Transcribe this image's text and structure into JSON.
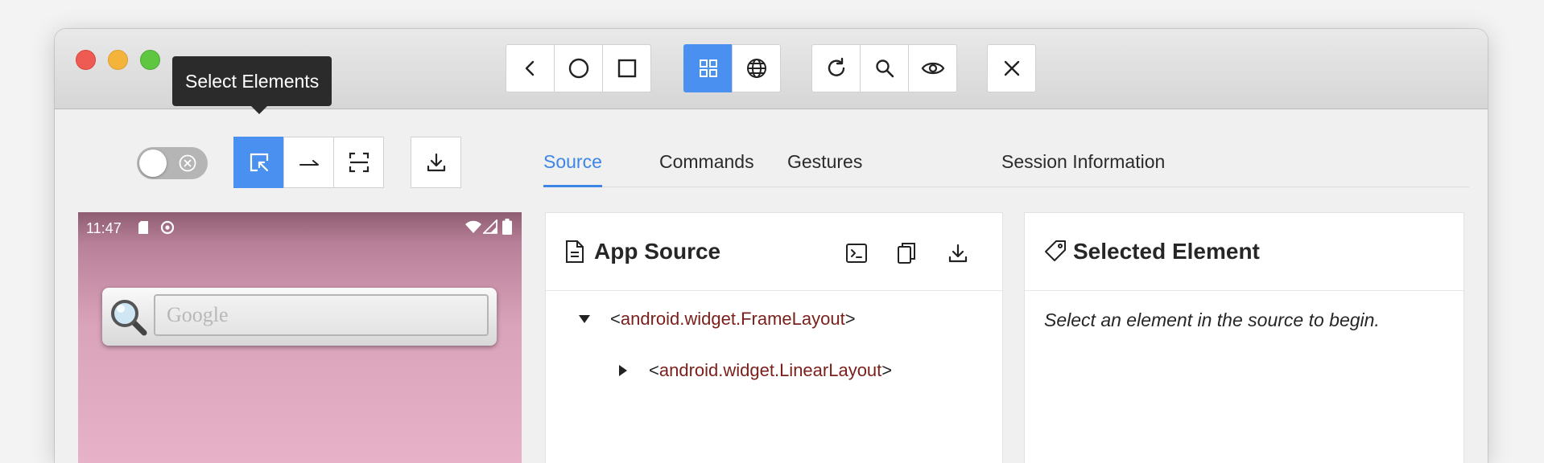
{
  "tooltip": {
    "text": "Select Elements"
  },
  "toolbar": {
    "groups": [
      [
        "back-icon",
        "home-circle-icon",
        "app-switch-square-icon"
      ],
      [
        "native-grid-icon",
        "web-globe-icon"
      ],
      [
        "refresh-icon",
        "search-icon",
        "eye-icon"
      ],
      [
        "close-icon"
      ]
    ],
    "active": "native-grid-icon"
  },
  "inspector_tools": {
    "toggle_on": false,
    "buttons": [
      "select-elements-icon",
      "swipe-arrow-icon",
      "tap-screen-icon"
    ],
    "active": "select-elements-icon",
    "download": "download-icon"
  },
  "tabs": [
    {
      "label": "Source",
      "active": true
    },
    {
      "label": "Commands",
      "active": false
    },
    {
      "label": "Gestures",
      "active": false
    },
    {
      "label": "Session Information",
      "active": false
    }
  ],
  "device": {
    "time": "11:47",
    "search_placeholder": "Google"
  },
  "app_source": {
    "title": "App Source",
    "actions": [
      "terminal-icon",
      "copy-icon",
      "download-icon"
    ],
    "tree": [
      {
        "open": "<",
        "tag": "android.widget.FrameLayout",
        "close": ">",
        "expanded": true
      },
      {
        "open": "<",
        "tag": "android.widget.LinearLayout",
        "close": ">",
        "expanded": false
      }
    ]
  },
  "selected_element": {
    "title": "Selected Element",
    "placeholder": "Select an element in the source to begin."
  },
  "colors": {
    "accent": "#4a90f0",
    "tag": "#7a1f1a",
    "tooltip_bg": "#2b2b2b"
  }
}
